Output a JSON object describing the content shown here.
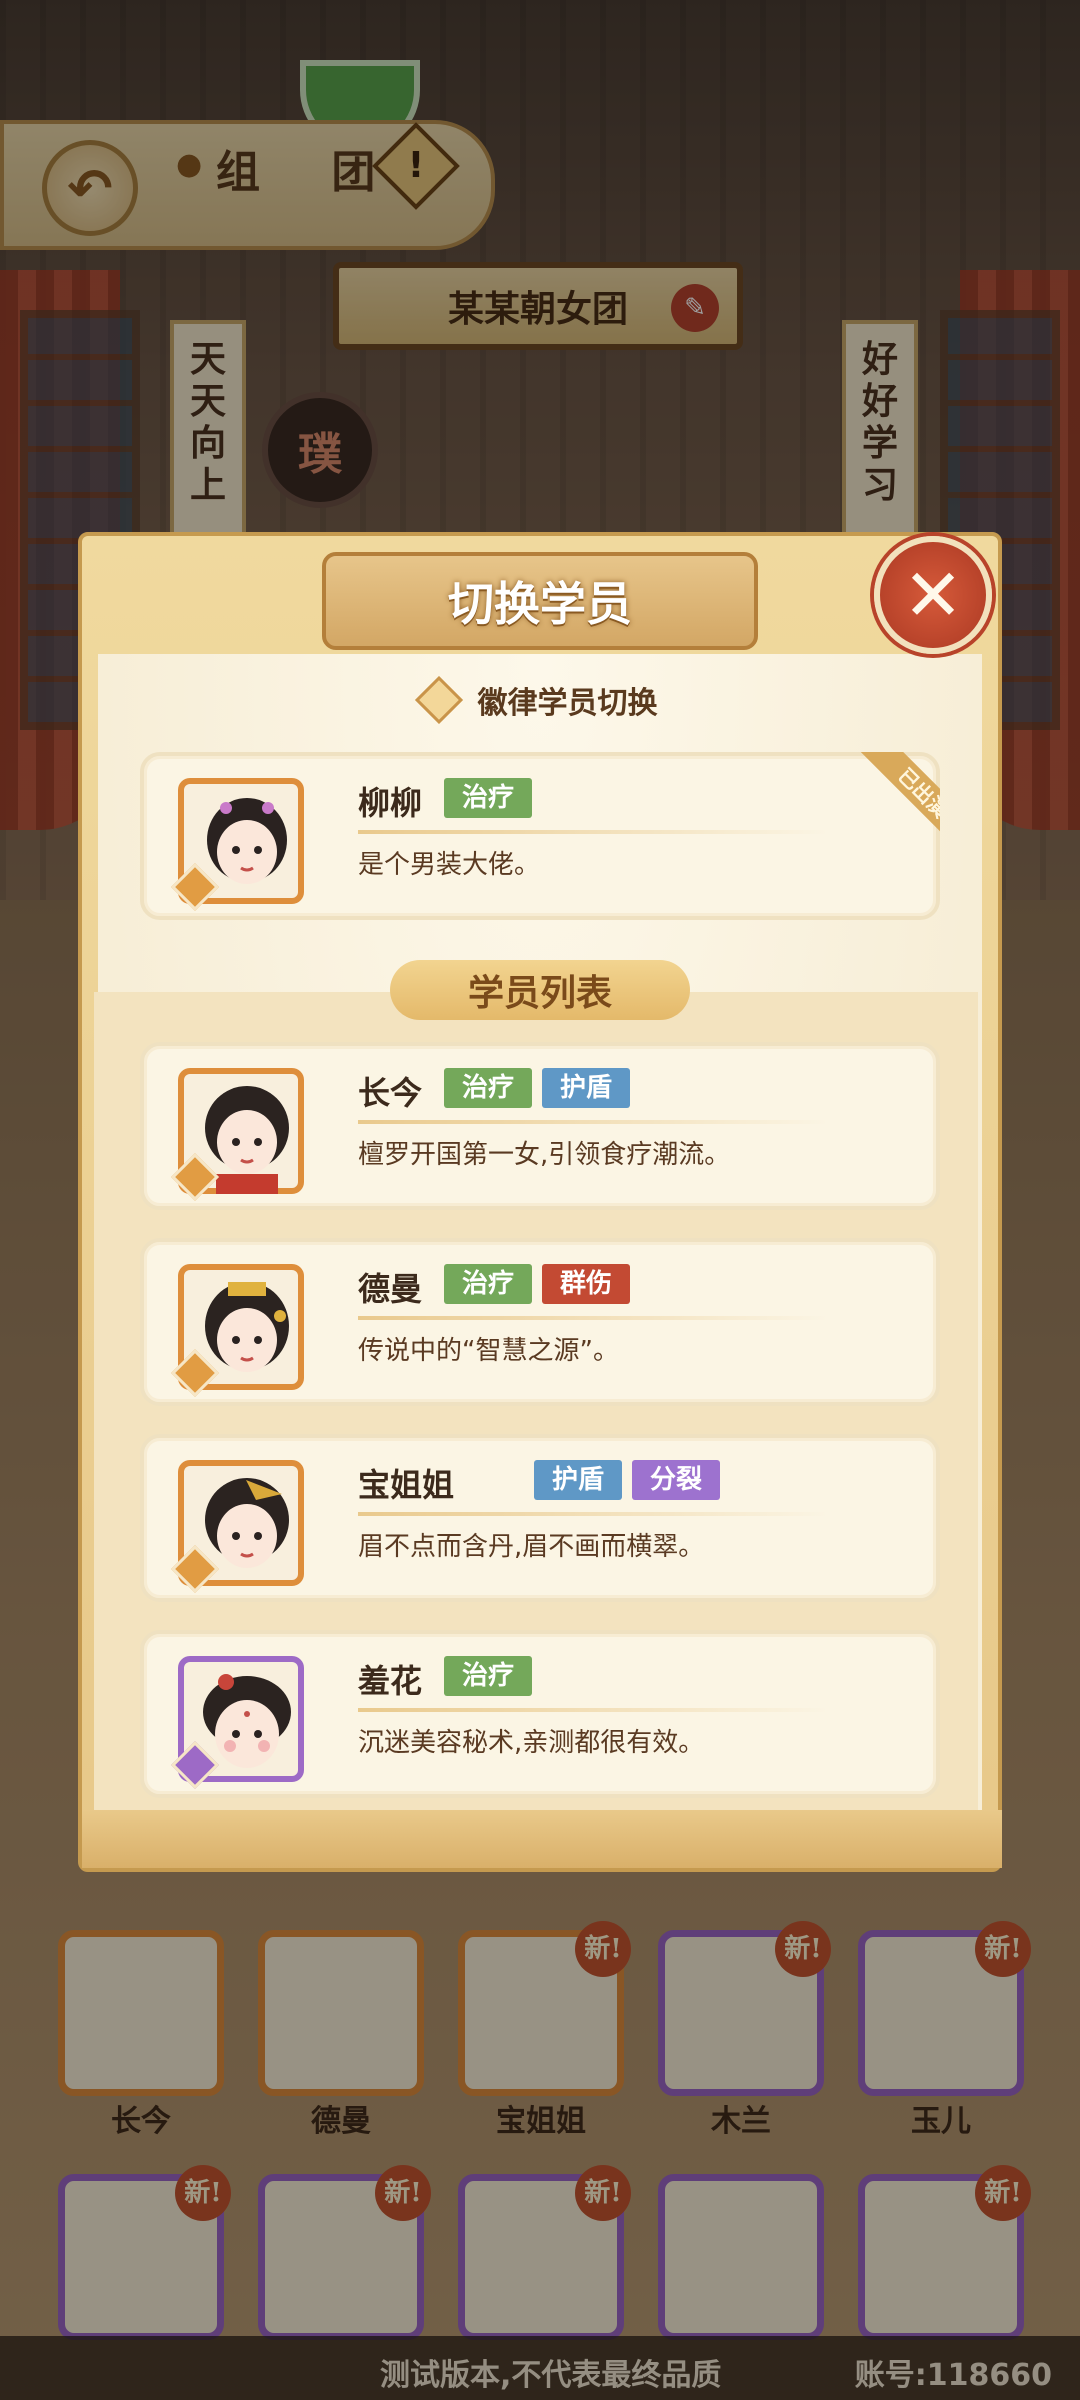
{
  "top_bar": {
    "title": "组 团",
    "info_label": "!"
  },
  "team": {
    "name": "某某朝女团",
    "banner_left": [
      "天",
      "天",
      "向",
      "上"
    ],
    "banner_right": [
      "好",
      "好",
      "学",
      "习"
    ],
    "emblem_char": "璞"
  },
  "modal": {
    "title": "切换学员",
    "section_badge": "徽律学员切换",
    "list_title": "学员列表",
    "current": {
      "name": "柳柳",
      "tags": [
        "治疗"
      ],
      "desc": "是个男装大佬。",
      "status": "已出演"
    },
    "students": [
      {
        "name": "长今",
        "tags": [
          "治疗",
          "护盾"
        ],
        "desc": "檀罗开国第一女,引领食疗潮流。"
      },
      {
        "name": "德曼",
        "tags": [
          "治疗",
          "群伤"
        ],
        "desc": "传说中的“智慧之源”。"
      },
      {
        "name": "宝姐姐",
        "tags": [
          "护盾",
          "分裂"
        ],
        "desc": "眉不点而含丹,眉不画而横翠。"
      },
      {
        "name": "羞花",
        "tags": [
          "治疗"
        ],
        "desc": "沉迷美容秘术,亲测都很有效。"
      }
    ]
  },
  "grid": {
    "new_label": "新!",
    "row1_names": [
      "长今",
      "德曼",
      "宝姐姐",
      "木兰",
      "玉儿"
    ]
  },
  "footer": {
    "notice": "测试版本,不代表最终品质",
    "account": "账号:118660"
  },
  "colors": {
    "heal": "#74a85a",
    "shield": "#5f98c6",
    "aoe": "#c34a33",
    "split": "#9d72cf",
    "close": "#c4492f"
  }
}
